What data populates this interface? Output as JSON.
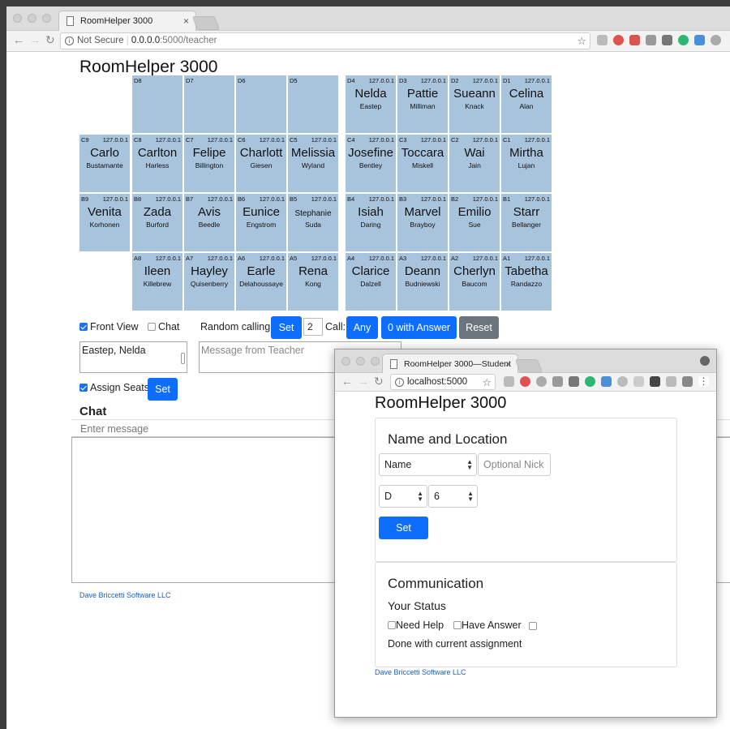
{
  "main_browser": {
    "tab_title": "RoomHelper 3000",
    "tab_close": "×",
    "url_security": "Not Secure",
    "url_host": "0.0.0.0",
    "url_path": ":5000/teacher",
    "star": "☆"
  },
  "teacher": {
    "title": "RoomHelper 3000",
    "seats": [
      {
        "id": "D8",
        "ip": "",
        "first": "",
        "last": ""
      },
      {
        "id": "D7",
        "ip": "",
        "first": "",
        "last": ""
      },
      {
        "id": "D6",
        "ip": "",
        "first": "",
        "last": ""
      },
      {
        "id": "D5",
        "ip": "",
        "first": "",
        "last": ""
      },
      {
        "id": "D4",
        "ip": "127.0.0.1",
        "first": "Nelda",
        "last": "Eastep"
      },
      {
        "id": "D3",
        "ip": "127.0.0.1",
        "first": "Pattie",
        "last": "Milliman"
      },
      {
        "id": "D2",
        "ip": "127.0.0.1",
        "first": "Sueann",
        "last": "Knack"
      },
      {
        "id": "D1",
        "ip": "127.0.0.1",
        "first": "Celina",
        "last": "Alan"
      },
      {
        "id": "C9",
        "ip": "127.0.0.1",
        "first": "Carlo",
        "last": "Bustamante"
      },
      {
        "id": "C8",
        "ip": "127.0.0.1",
        "first": "Carlton",
        "last": "Harless"
      },
      {
        "id": "C7",
        "ip": "127.0.0.1",
        "first": "Felipe",
        "last": "Billington"
      },
      {
        "id": "C6",
        "ip": "127.0.0.1",
        "first": "Charlott",
        "last": "Giesen"
      },
      {
        "id": "C5",
        "ip": "127.0.0.1",
        "first": "Melissia",
        "last": "Wyland"
      },
      {
        "id": "C4",
        "ip": "127.0.0.1",
        "first": "Josefine",
        "last": "Bentley"
      },
      {
        "id": "C3",
        "ip": "127.0.0.1",
        "first": "Toccara",
        "last": "Miskell"
      },
      {
        "id": "C2",
        "ip": "127.0.0.1",
        "first": "Wai",
        "last": "Jain"
      },
      {
        "id": "C1",
        "ip": "127.0.0.1",
        "first": "Mirtha",
        "last": "Lujan"
      },
      {
        "id": "B9",
        "ip": "127.0.0.1",
        "first": "Venita",
        "last": "Korhonen"
      },
      {
        "id": "B8",
        "ip": "127.0.0.1",
        "first": "Zada",
        "last": "Burford"
      },
      {
        "id": "B7",
        "ip": "127.0.0.1",
        "first": "Avis",
        "last": "Beedle"
      },
      {
        "id": "B6",
        "ip": "127.0.0.1",
        "first": "Eunice",
        "last": "Engstrom"
      },
      {
        "id": "B5",
        "ip": "127.0.0.1",
        "first": "Stephanie",
        "last": "Suda"
      },
      {
        "id": "B4",
        "ip": "127.0.0.1",
        "first": "Isiah",
        "last": "Daring"
      },
      {
        "id": "B3",
        "ip": "127.0.0.1",
        "first": "Marvel",
        "last": "Brayboy"
      },
      {
        "id": "B2",
        "ip": "127.0.0.1",
        "first": "Emilio",
        "last": "Sue"
      },
      {
        "id": "B1",
        "ip": "127.0.0.1",
        "first": "Starr",
        "last": "Bellanger"
      },
      {
        "id": "A8",
        "ip": "127.0.0.1",
        "first": "Ileen",
        "last": "Killebrew"
      },
      {
        "id": "A7",
        "ip": "127.0.0.1",
        "first": "Hayley",
        "last": "Quisenberry"
      },
      {
        "id": "A6",
        "ip": "127.0.0.1",
        "first": "Earle",
        "last": "Delahoussaye"
      },
      {
        "id": "A5",
        "ip": "127.0.0.1",
        "first": "Rena",
        "last": "Kong"
      },
      {
        "id": "A4",
        "ip": "127.0.0.1",
        "first": "Clarice",
        "last": "Dalzell"
      },
      {
        "id": "A3",
        "ip": "127.0.0.1",
        "first": "Deann",
        "last": "Budniewski"
      },
      {
        "id": "A2",
        "ip": "127.0.0.1",
        "first": "Cherlyn",
        "last": "Baucom"
      },
      {
        "id": "A1",
        "ip": "127.0.0.1",
        "first": "Tabetha",
        "last": "Randazzo"
      }
    ],
    "front_view_label": "Front View",
    "chat_label": "Chat",
    "random_calling_label": "Random calling:",
    "set_label": "Set",
    "random_count": "2",
    "call_label": "Call:",
    "any_label": "Any",
    "with_answer_label": "0 with Answer",
    "reset_label": "Reset",
    "selected_student": "Eastep, Nelda",
    "message_placeholder": "Message from Teacher",
    "assign_seats_label": "Assign Seats",
    "assign_set_label": "Set",
    "chat_heading": "Chat",
    "chat_placeholder": "Enter message",
    "footer": "Dave Briccetti Software LLC"
  },
  "student_browser": {
    "tab_title": "RoomHelper 3000—Student",
    "tab_close": "×",
    "url": "localhost:5000",
    "star": "☆"
  },
  "student": {
    "title": "RoomHelper 3000",
    "name_location_heading": "Name and Location",
    "name_select": "Name",
    "nick_placeholder": "Optional Nick",
    "row_select": "D",
    "seat_select": "6",
    "set_label": "Set",
    "communication_heading": "Communication",
    "your_status_heading": "Your Status",
    "need_help_label": "Need Help",
    "have_answer_label": "Have Answer",
    "done_label": "Done with current assignment",
    "footer": "Dave Briccetti Software LLC"
  }
}
